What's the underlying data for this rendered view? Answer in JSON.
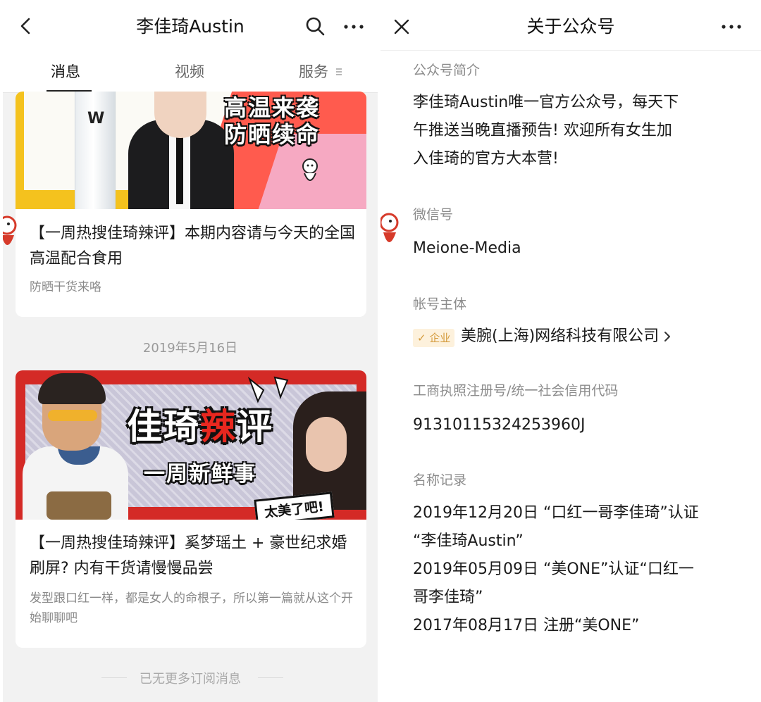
{
  "left": {
    "title": "李佳琦Austin",
    "tabs": [
      {
        "label": "消息",
        "active": true
      },
      {
        "label": "视频",
        "active": false
      },
      {
        "label": "服务",
        "active": false
      }
    ],
    "articles": [
      {
        "banner_text_line1": "高温来袭",
        "banner_text_line2": "防晒续命",
        "bottle_text": "W",
        "title": "【一周热搜佳琦辣评】本期内容请与今天的全国高温配合食用",
        "subtitle": "防晒干货来咯"
      },
      {
        "banner_title_a": "佳琦",
        "banner_title_b": "辣",
        "banner_title_c": "评",
        "banner_subtitle": "一周新鲜事",
        "banner_tag": "太美了吧!",
        "title": "【一周热搜佳琦辣评】奚梦瑶土 + 豪世纪求婚刷屏? 内有干货请慢慢品尝",
        "subtitle": "发型跟口红一样，都是女人的命根子，所以第一篇就从这个开始聊聊吧"
      }
    ],
    "date_label": "2019年5月16日",
    "end_note": "已无更多订阅消息",
    "icons": {
      "back": "back-arrow-icon",
      "search": "search-icon",
      "more": "more-dots-icon",
      "menu": "menu-lines-icon"
    }
  },
  "right": {
    "title": "关于公众号",
    "intro_label": "公众号简介",
    "intro_lines": [
      "李佳琦Austin唯一官方公众号，每天下",
      "午推送当晚直播预告! 欢迎所有女生加",
      "入佳琦的官方大本营!"
    ],
    "wechat_label": "微信号",
    "wechat_id": "Meione-Media",
    "owner_label": "帐号主体",
    "owner_badge": "✓ 企业",
    "owner_name": "美腕(上海)网络科技有限公司",
    "license_label": "工商执照注册号/统一社会信用代码",
    "license_value": "91310115324253960J",
    "history_label": "名称记录",
    "history_lines": [
      "2019年12月20日 “口红一哥李佳琦”认证",
      "“李佳琦Austin”",
      "2019年05月09日 “美ONE”认证“口红一",
      "哥李佳琦”",
      "2017年08月17日 注册“美ONE”"
    ],
    "icons": {
      "close": "close-icon",
      "more": "more-dots-icon",
      "chevron": "chevron-right-icon"
    }
  },
  "colors": {
    "accent_yellow": "#f4c21e",
    "accent_red": "#d42a26",
    "badge_bg": "#fdf1dc",
    "badge_text": "#d49a3b",
    "muted_text": "#8c8c8c"
  }
}
